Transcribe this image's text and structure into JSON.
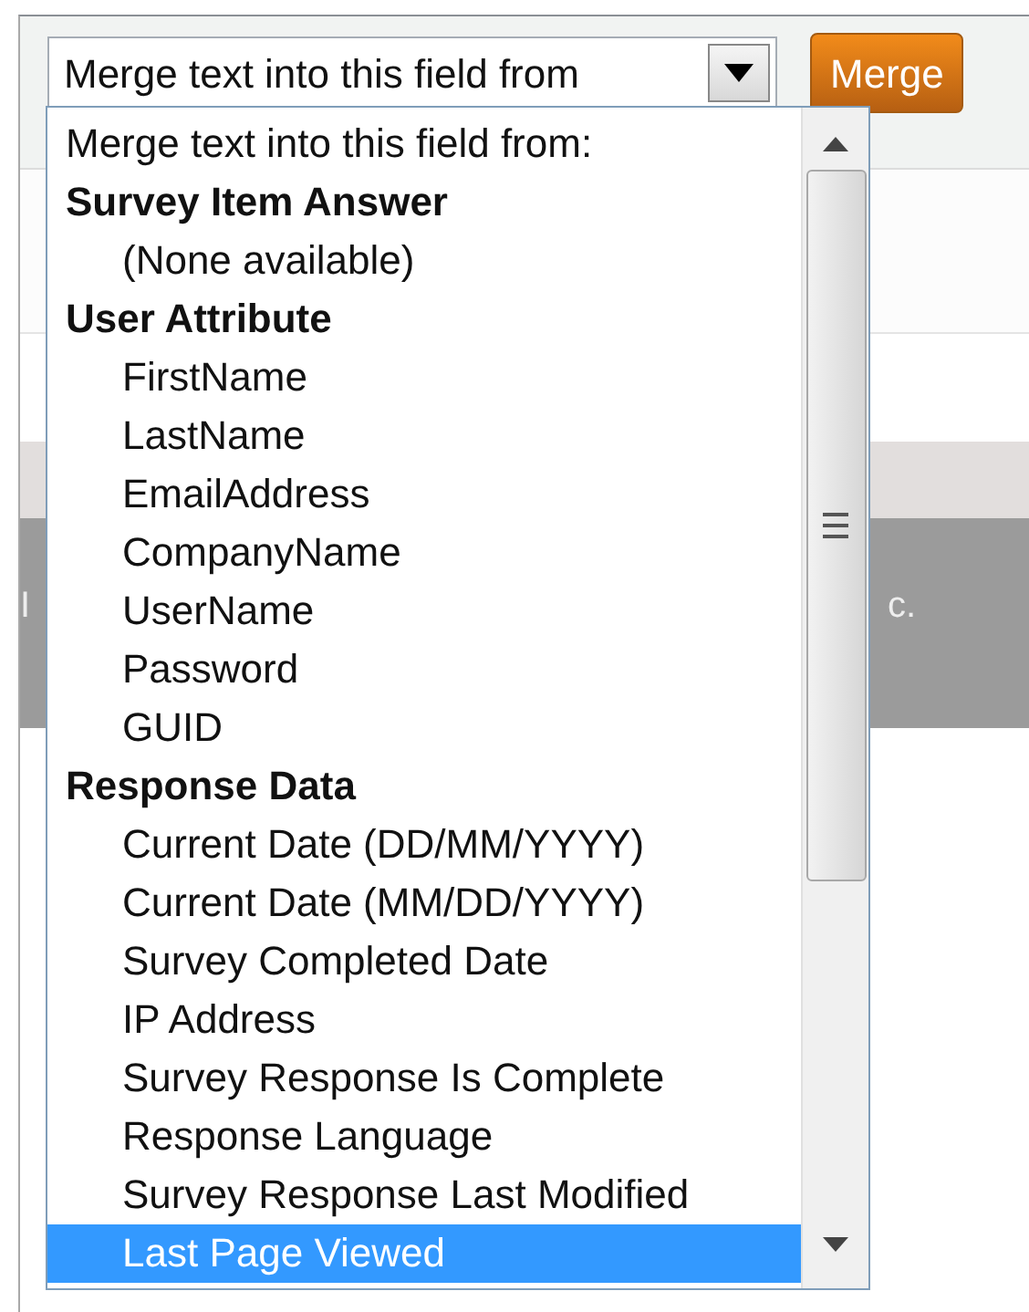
{
  "merge_select": {
    "value": "Merge text into this field from"
  },
  "merge_button": {
    "label": "Merge"
  },
  "background_texts": [
    "I",
    "c."
  ],
  "dropdown": {
    "items": [
      {
        "kind": "header",
        "label": "Merge text into this field from:",
        "selected": false
      },
      {
        "kind": "group",
        "label": "Survey Item Answer",
        "selected": false
      },
      {
        "kind": "option",
        "label": "(None available)",
        "selected": false
      },
      {
        "kind": "group",
        "label": "User Attribute",
        "selected": false
      },
      {
        "kind": "option",
        "label": "FirstName",
        "selected": false
      },
      {
        "kind": "option",
        "label": "LastName",
        "selected": false
      },
      {
        "kind": "option",
        "label": "EmailAddress",
        "selected": false
      },
      {
        "kind": "option",
        "label": "CompanyName",
        "selected": false
      },
      {
        "kind": "option",
        "label": "UserName",
        "selected": false
      },
      {
        "kind": "option",
        "label": "Password",
        "selected": false
      },
      {
        "kind": "option",
        "label": "GUID",
        "selected": false
      },
      {
        "kind": "group",
        "label": "Response Data",
        "selected": false
      },
      {
        "kind": "option",
        "label": "Current Date (DD/MM/YYYY)",
        "selected": false
      },
      {
        "kind": "option",
        "label": "Current Date (MM/DD/YYYY)",
        "selected": false
      },
      {
        "kind": "option",
        "label": "Survey Completed Date",
        "selected": false
      },
      {
        "kind": "option",
        "label": "IP Address",
        "selected": false
      },
      {
        "kind": "option",
        "label": "Survey Response Is Complete",
        "selected": false
      },
      {
        "kind": "option",
        "label": "Response Language",
        "selected": false
      },
      {
        "kind": "option",
        "label": "Survey Response Last Modified",
        "selected": false
      },
      {
        "kind": "option",
        "label": "Last Page Viewed",
        "selected": true
      }
    ]
  }
}
